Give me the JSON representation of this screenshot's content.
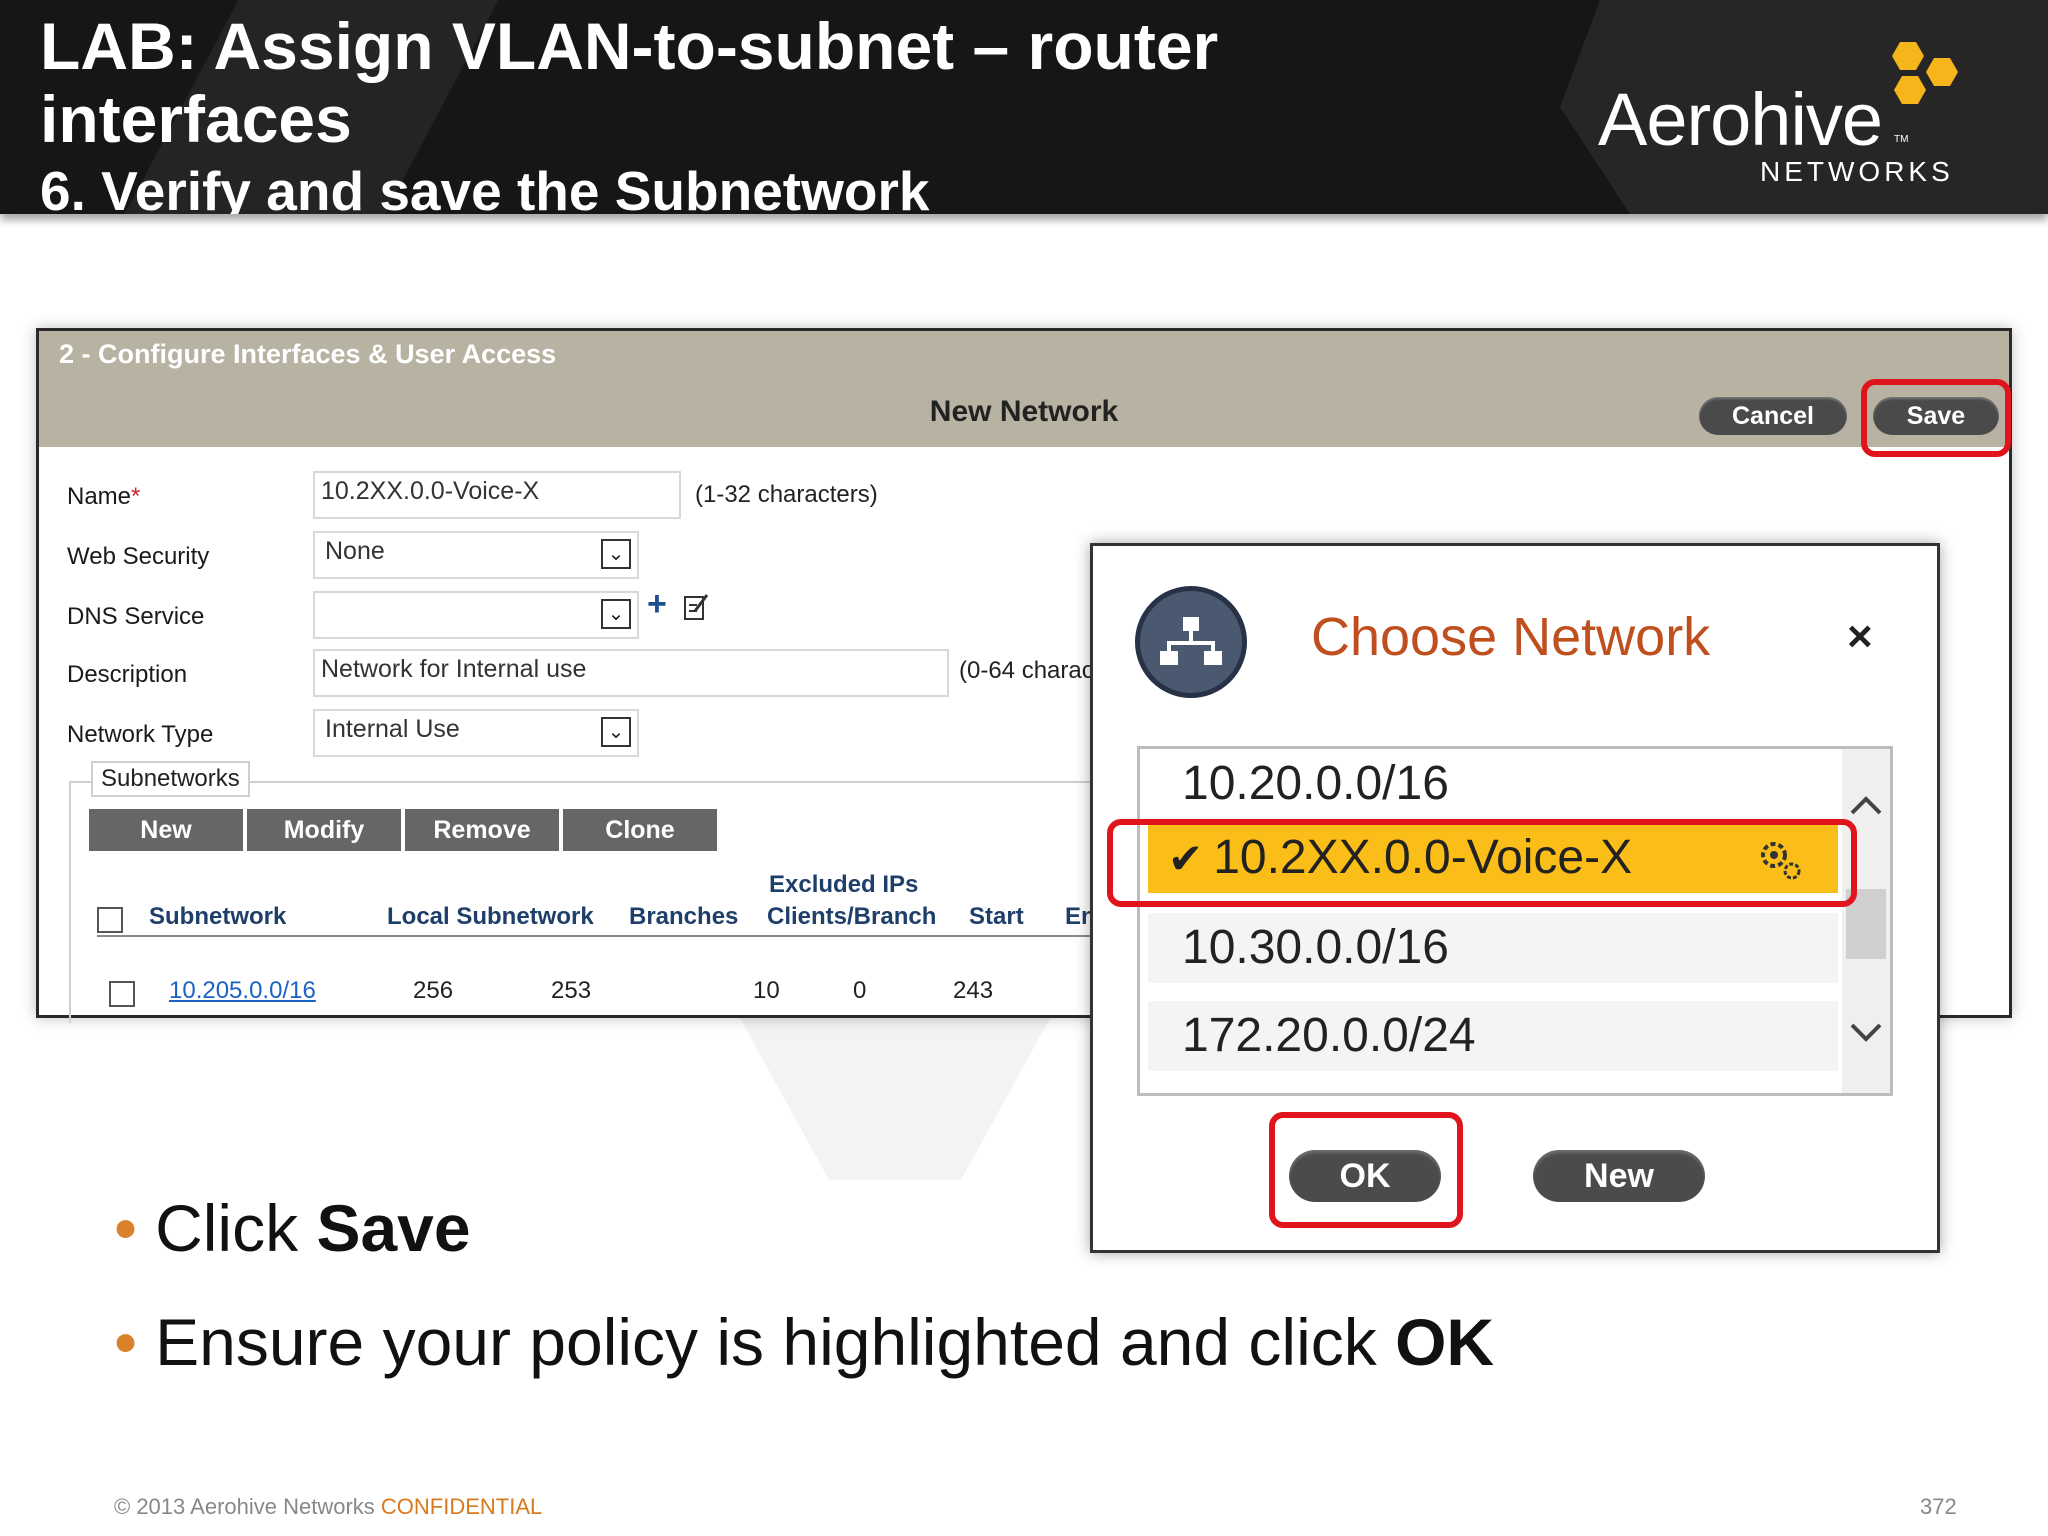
{
  "slide": {
    "title_line1": "LAB: Assign VLAN-to-subnet – router",
    "title_line2": "interfaces",
    "subtitle": "6. Verify and save the Subnetwork",
    "logo_name": "Aerohive",
    "logo_sub": "NETWORKS",
    "logo_tm": "TM",
    "bullets": [
      {
        "text": "Click ",
        "bold": "Save"
      },
      {
        "text": "Ensure your policy is highlighted and click ",
        "bold": "OK"
      }
    ],
    "footer_copyright": "© 2013 Aerohive Networks ",
    "footer_confidential": "CONFIDENTIAL",
    "page_number": "372",
    "colors": {
      "accent_orange": "#d9822b",
      "brand_yellow": "#f5b51b",
      "header_bg": "#161616"
    }
  },
  "app": {
    "step_title": "2 - Configure Interfaces & User Access",
    "panel_title": "New Network",
    "cancel_label": "Cancel",
    "save_label": "Save",
    "form": {
      "name_label": "Name",
      "name_required_mark": "*",
      "name_value": "10.2XX.0.0-Voice-X",
      "name_hint": "(1-32 characters)",
      "web_security_label": "Web Security",
      "web_security_value": "None",
      "dns_service_label": "DNS Service",
      "dns_service_value": "",
      "description_label": "Description",
      "description_value": "Network for Internal use",
      "description_hint": "(0-64 charac",
      "network_type_label": "Network Type",
      "network_type_value": "Internal Use"
    },
    "subnetworks": {
      "tab_label": "Subnetworks",
      "buttons": [
        "New",
        "Modify",
        "Remove",
        "Clone"
      ],
      "headers": {
        "subnetwork": "Subnetwork",
        "local_subnetwork": "Local Subnetwork",
        "branches": "Branches",
        "excluded_line1": "Excluded IPs",
        "excluded_line2": "Clients/Branch",
        "start": "Start",
        "end_partial": "En"
      },
      "rows": [
        {
          "subnetwork": "10.205.0.0/16",
          "local_subnetwork": "256",
          "branches": "253",
          "excluded": "10",
          "clients": "0",
          "start": "243"
        }
      ]
    }
  },
  "dialog": {
    "title": "Choose Network",
    "close_glyph": "×",
    "items": [
      "10.20.0.0/16",
      "10.2XX.0.0-Voice-X",
      "10.30.0.0/16",
      "172.20.0.0/24"
    ],
    "selected_index": 1,
    "check_glyph": "✔",
    "ok_label": "OK",
    "new_label": "New"
  }
}
